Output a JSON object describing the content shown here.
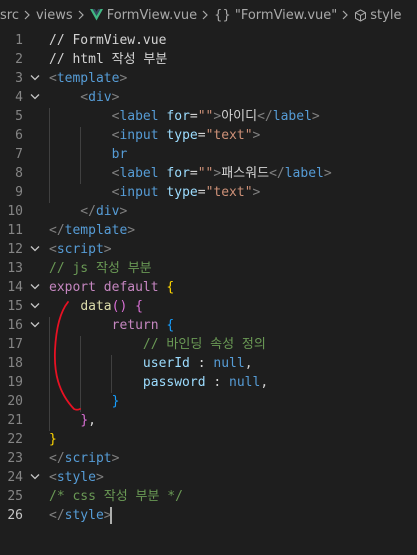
{
  "breadcrumb": {
    "items": [
      "src",
      "views",
      "FormView.vue",
      "{} \"FormView.vue\"",
      "style"
    ]
  },
  "editor": {
    "line_numbers": [
      "1",
      "2",
      "3",
      "4",
      "5",
      "6",
      "7",
      "8",
      "9",
      "10",
      "11",
      "12",
      "13",
      "14",
      "15",
      "16",
      "17",
      "18",
      "19",
      "20",
      "21",
      "22",
      "23",
      "24",
      "25",
      "26"
    ],
    "active_line": "26",
    "lines": [
      [
        {
          "t": "// FormView.vue",
          "c": "t-text"
        }
      ],
      [
        {
          "t": "// html 작성 부분",
          "c": "t-text"
        }
      ],
      [
        {
          "t": "<",
          "c": "t-punct"
        },
        {
          "t": "template",
          "c": "t-tag"
        },
        {
          "t": ">",
          "c": "t-punct"
        }
      ],
      [
        {
          "t": "    <",
          "c": "t-punct"
        },
        {
          "t": "div",
          "c": "t-tag"
        },
        {
          "t": ">",
          "c": "t-punct"
        }
      ],
      [
        {
          "t": "        <",
          "c": "t-punct"
        },
        {
          "t": "label",
          "c": "t-tag"
        },
        {
          "t": " ",
          "c": "t-text"
        },
        {
          "t": "for",
          "c": "t-attr"
        },
        {
          "t": "=",
          "c": "t-text"
        },
        {
          "t": "\"\"",
          "c": "t-str"
        },
        {
          "t": ">",
          "c": "t-punct"
        },
        {
          "t": "아이디",
          "c": "t-text"
        },
        {
          "t": "</",
          "c": "t-punct"
        },
        {
          "t": "label",
          "c": "t-tag"
        },
        {
          "t": ">",
          "c": "t-punct"
        }
      ],
      [
        {
          "t": "        <",
          "c": "t-punct"
        },
        {
          "t": "input",
          "c": "t-tag"
        },
        {
          "t": " ",
          "c": "t-text"
        },
        {
          "t": "type",
          "c": "t-attr"
        },
        {
          "t": "=",
          "c": "t-text"
        },
        {
          "t": "\"text\"",
          "c": "t-str"
        },
        {
          "t": ">",
          "c": "t-punct"
        }
      ],
      [
        {
          "t": "        ",
          "c": "t-text"
        },
        {
          "t": "br",
          "c": "t-tag"
        }
      ],
      [
        {
          "t": "        <",
          "c": "t-punct"
        },
        {
          "t": "label",
          "c": "t-tag"
        },
        {
          "t": " ",
          "c": "t-text"
        },
        {
          "t": "for",
          "c": "t-attr"
        },
        {
          "t": "=",
          "c": "t-text"
        },
        {
          "t": "\"\"",
          "c": "t-str"
        },
        {
          "t": ">",
          "c": "t-punct"
        },
        {
          "t": "패스워드",
          "c": "t-text"
        },
        {
          "t": "</",
          "c": "t-punct"
        },
        {
          "t": "label",
          "c": "t-tag"
        },
        {
          "t": ">",
          "c": "t-punct"
        }
      ],
      [
        {
          "t": "        <",
          "c": "t-punct"
        },
        {
          "t": "input",
          "c": "t-tag"
        },
        {
          "t": " ",
          "c": "t-text"
        },
        {
          "t": "type",
          "c": "t-attr"
        },
        {
          "t": "=",
          "c": "t-text"
        },
        {
          "t": "\"text\"",
          "c": "t-str"
        },
        {
          "t": ">",
          "c": "t-punct"
        }
      ],
      [
        {
          "t": "    </",
          "c": "t-punct"
        },
        {
          "t": "div",
          "c": "t-tag"
        },
        {
          "t": ">",
          "c": "t-punct"
        }
      ],
      [
        {
          "t": "</",
          "c": "t-punct"
        },
        {
          "t": "template",
          "c": "t-tag"
        },
        {
          "t": ">",
          "c": "t-punct"
        }
      ],
      [
        {
          "t": "<",
          "c": "t-punct"
        },
        {
          "t": "script",
          "c": "t-tag"
        },
        {
          "t": ">",
          "c": "t-punct"
        }
      ],
      [
        {
          "t": "// js 작성 부분",
          "c": "t-comment"
        }
      ],
      [
        {
          "t": "export",
          "c": "t-kw"
        },
        {
          "t": " ",
          "c": "t-text"
        },
        {
          "t": "default",
          "c": "t-kw"
        },
        {
          "t": " ",
          "c": "t-text"
        },
        {
          "t": "{",
          "c": "t-br1"
        }
      ],
      [
        {
          "t": "    ",
          "c": "t-text"
        },
        {
          "t": "data",
          "c": "t-fn"
        },
        {
          "t": "()",
          "c": "t-br2"
        },
        {
          "t": " ",
          "c": "t-text"
        },
        {
          "t": "{",
          "c": "t-br2"
        }
      ],
      [
        {
          "t": "        ",
          "c": "t-text"
        },
        {
          "t": "return",
          "c": "t-kw"
        },
        {
          "t": " ",
          "c": "t-text"
        },
        {
          "t": "{",
          "c": "t-br3"
        }
      ],
      [
        {
          "t": "            ",
          "c": "t-text"
        },
        {
          "t": "// 바인딩 속성 정의",
          "c": "t-comment"
        }
      ],
      [
        {
          "t": "            ",
          "c": "t-text"
        },
        {
          "t": "userId",
          "c": "t-prop"
        },
        {
          "t": " : ",
          "c": "t-text"
        },
        {
          "t": "null",
          "c": "t-null"
        },
        {
          "t": ",",
          "c": "t-text"
        }
      ],
      [
        {
          "t": "            ",
          "c": "t-text"
        },
        {
          "t": "password",
          "c": "t-prop"
        },
        {
          "t": " : ",
          "c": "t-text"
        },
        {
          "t": "null",
          "c": "t-null"
        },
        {
          "t": ",",
          "c": "t-text"
        }
      ],
      [
        {
          "t": "        ",
          "c": "t-text"
        },
        {
          "t": "}",
          "c": "t-br3"
        }
      ],
      [
        {
          "t": "    ",
          "c": "t-text"
        },
        {
          "t": "}",
          "c": "t-br2"
        },
        {
          "t": ",",
          "c": "t-text"
        }
      ],
      [
        {
          "t": "}",
          "c": "t-br1"
        }
      ],
      [
        {
          "t": "</",
          "c": "t-punct"
        },
        {
          "t": "script",
          "c": "t-tag"
        },
        {
          "t": ">",
          "c": "t-punct"
        }
      ],
      [
        {
          "t": "<",
          "c": "t-punct"
        },
        {
          "t": "style",
          "c": "t-tag"
        },
        {
          "t": ">",
          "c": "t-punct"
        }
      ],
      [
        {
          "t": "/* css 작성 부분 */",
          "c": "t-comment"
        }
      ],
      [
        {
          "t": "</",
          "c": "t-punct"
        },
        {
          "t": "style",
          "c": "t-tag"
        },
        {
          "t": ">",
          "c": "t-punct"
        }
      ]
    ]
  },
  "colors": {
    "background": "#1e1e1e",
    "annotation_stroke": "#e81123"
  },
  "icons": [
    "chevron-right-icon",
    "vue-logo-icon",
    "cube-icon",
    "fold-chevron-icon"
  ]
}
